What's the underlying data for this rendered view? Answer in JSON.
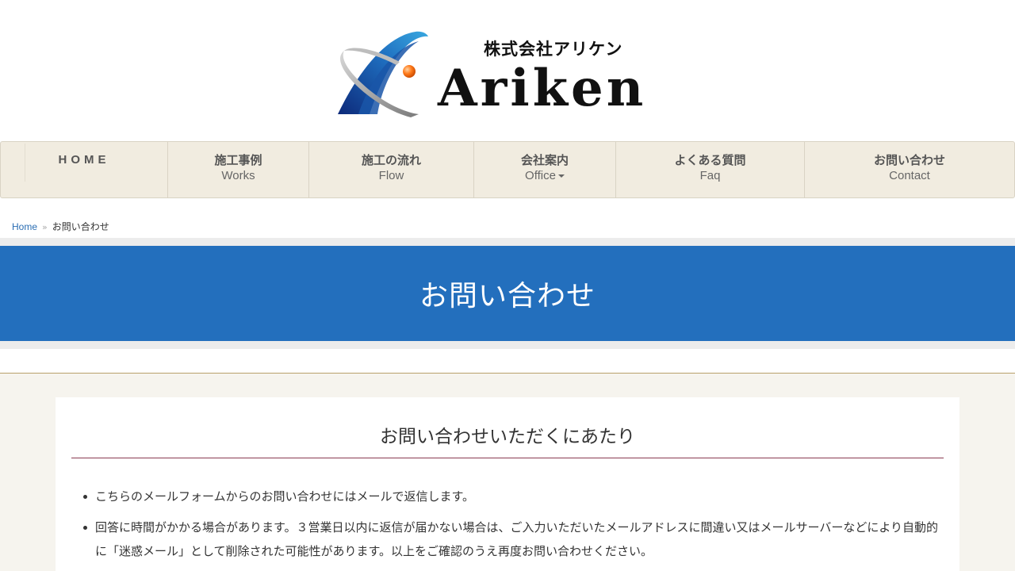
{
  "logo": {
    "company": "株式会社アリケン",
    "name": "Ariken"
  },
  "nav": {
    "items": [
      {
        "jp": "HOME",
        "en": ""
      },
      {
        "jp": "施工事例",
        "en": "Works"
      },
      {
        "jp": "施工の流れ",
        "en": "Flow"
      },
      {
        "jp": "会社案内",
        "en": "Office"
      },
      {
        "jp": "よくある質問",
        "en": "Faq"
      },
      {
        "jp": "お問い合わせ",
        "en": "Contact"
      }
    ]
  },
  "breadcrumb": {
    "home": "Home",
    "separator": "»",
    "current": "お問い合わせ"
  },
  "page": {
    "title": "お問い合わせ"
  },
  "section": {
    "heading": "お問い合わせいただくにあたり",
    "bullets": [
      "こちらのメールフォームからのお問い合わせにはメールで返信します。",
      "回答に時間がかかる場合があります。３営業日以内に返信が届かない場合は、ご入力いただいたメールアドレスに間違い又はメールサーバーなどにより自動的に「迷惑メール」として削除された可能性があります。以上をご確認のうえ再度お問い合わせください。"
    ]
  },
  "colors": {
    "title_band": "#236fbd",
    "nav_bg": "#f1ece0",
    "heading_rule": "#8a3a52",
    "content_bg": "#f6f4ee"
  }
}
